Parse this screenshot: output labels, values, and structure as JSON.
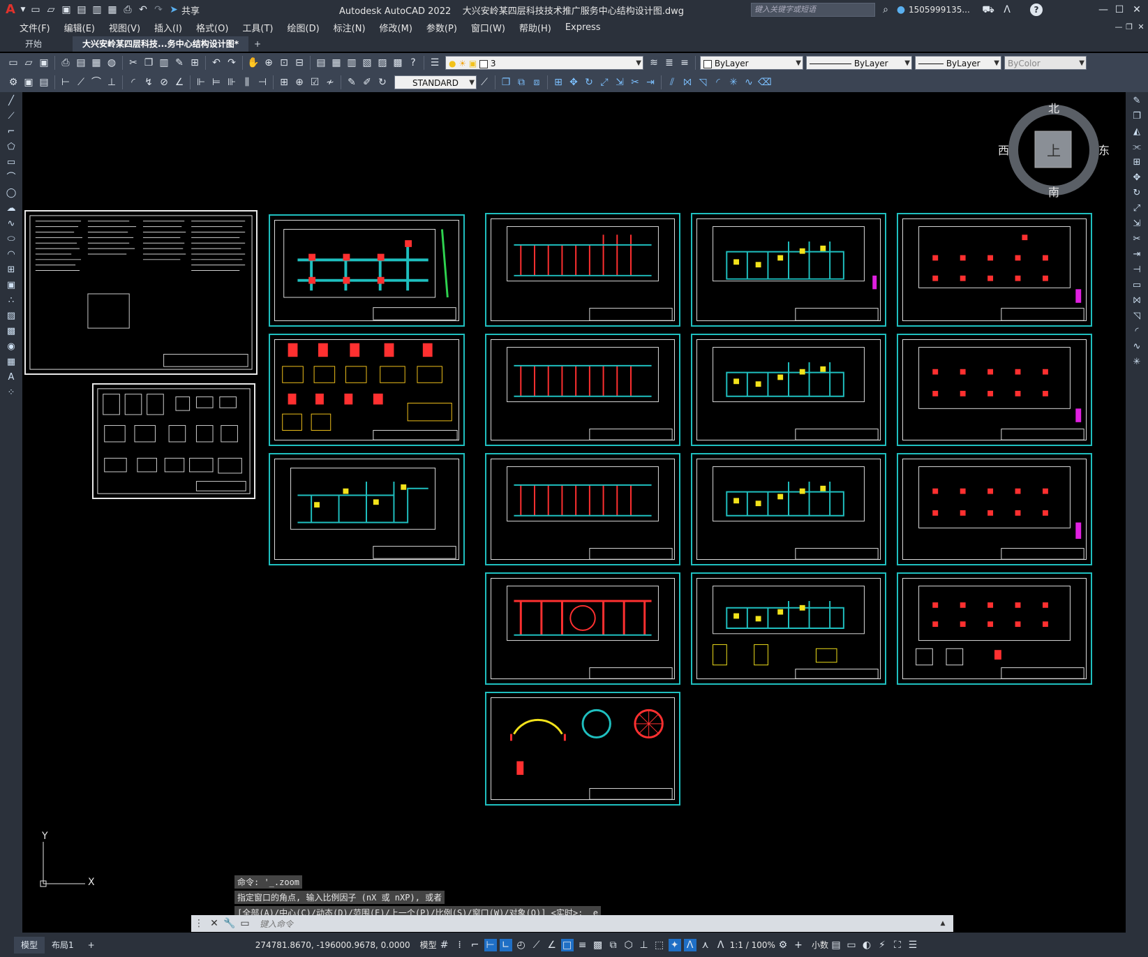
{
  "app": {
    "title": "Autodesk AutoCAD 2022    大兴安岭某四层科技技术推广服务中心结构设计图.dwg",
    "share_label": "共享",
    "search_placeholder": "键入关键字或短语",
    "user": "1505999135...",
    "help": "?"
  },
  "menu": [
    "文件(F)",
    "编辑(E)",
    "视图(V)",
    "插入(I)",
    "格式(O)",
    "工具(T)",
    "绘图(D)",
    "标注(N)",
    "修改(M)",
    "参数(P)",
    "窗口(W)",
    "帮助(H)",
    "Express"
  ],
  "tabs": {
    "start": "开始",
    "doc": "大兴安岭某四层科技...务中心结构设计图*",
    "add": "+"
  },
  "layer": {
    "current": "3"
  },
  "properties": {
    "color": "ByLayer",
    "linetype": "ByLayer",
    "lineweight": "ByLayer",
    "plotstyle": "ByColor"
  },
  "textstyle": "STANDARD",
  "viewcube": {
    "north": "北",
    "south": "南",
    "east": "东",
    "west": "西",
    "face": "上"
  },
  "ucs": {
    "x": "X",
    "y": "Y"
  },
  "command_history": [
    "命令: '_.zoom",
    "指定窗口的角点, 输入比例因子 (nX 或 nXP), 或者",
    "[全部(A)/中心(C)/动态(D)/范围(E)/上一个(P)/比例(S)/窗口(W)/对象(O)] <实时>: _e"
  ],
  "command_placeholder": "键入命令",
  "status": {
    "tab_model": "模型",
    "tab_layout": "布局1",
    "coords": "274781.8670, -196000.9678, 0.0000",
    "space": "模型",
    "scale": "1:1 / 100%",
    "units": "小数"
  },
  "colors": {
    "sheet_border": "#1fbfbf",
    "titlebar": "#2b313b",
    "toolbar": "#3b4453"
  }
}
